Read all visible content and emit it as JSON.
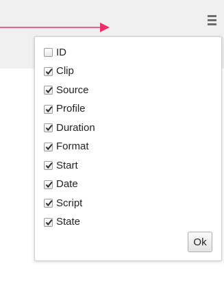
{
  "columns": [
    {
      "label": "ID",
      "checked": false
    },
    {
      "label": "Clip",
      "checked": true
    },
    {
      "label": "Source",
      "checked": true
    },
    {
      "label": "Profile",
      "checked": true
    },
    {
      "label": "Duration",
      "checked": true
    },
    {
      "label": "Format",
      "checked": true
    },
    {
      "label": "Start",
      "checked": true
    },
    {
      "label": "Date",
      "checked": true
    },
    {
      "label": "Script",
      "checked": true
    },
    {
      "label": "State",
      "checked": true
    }
  ],
  "ok_label": "Ok",
  "colors": {
    "arrow": "#e8306a",
    "header_background": "#f0f0f0",
    "menu_icon": "#6c6c6c"
  }
}
